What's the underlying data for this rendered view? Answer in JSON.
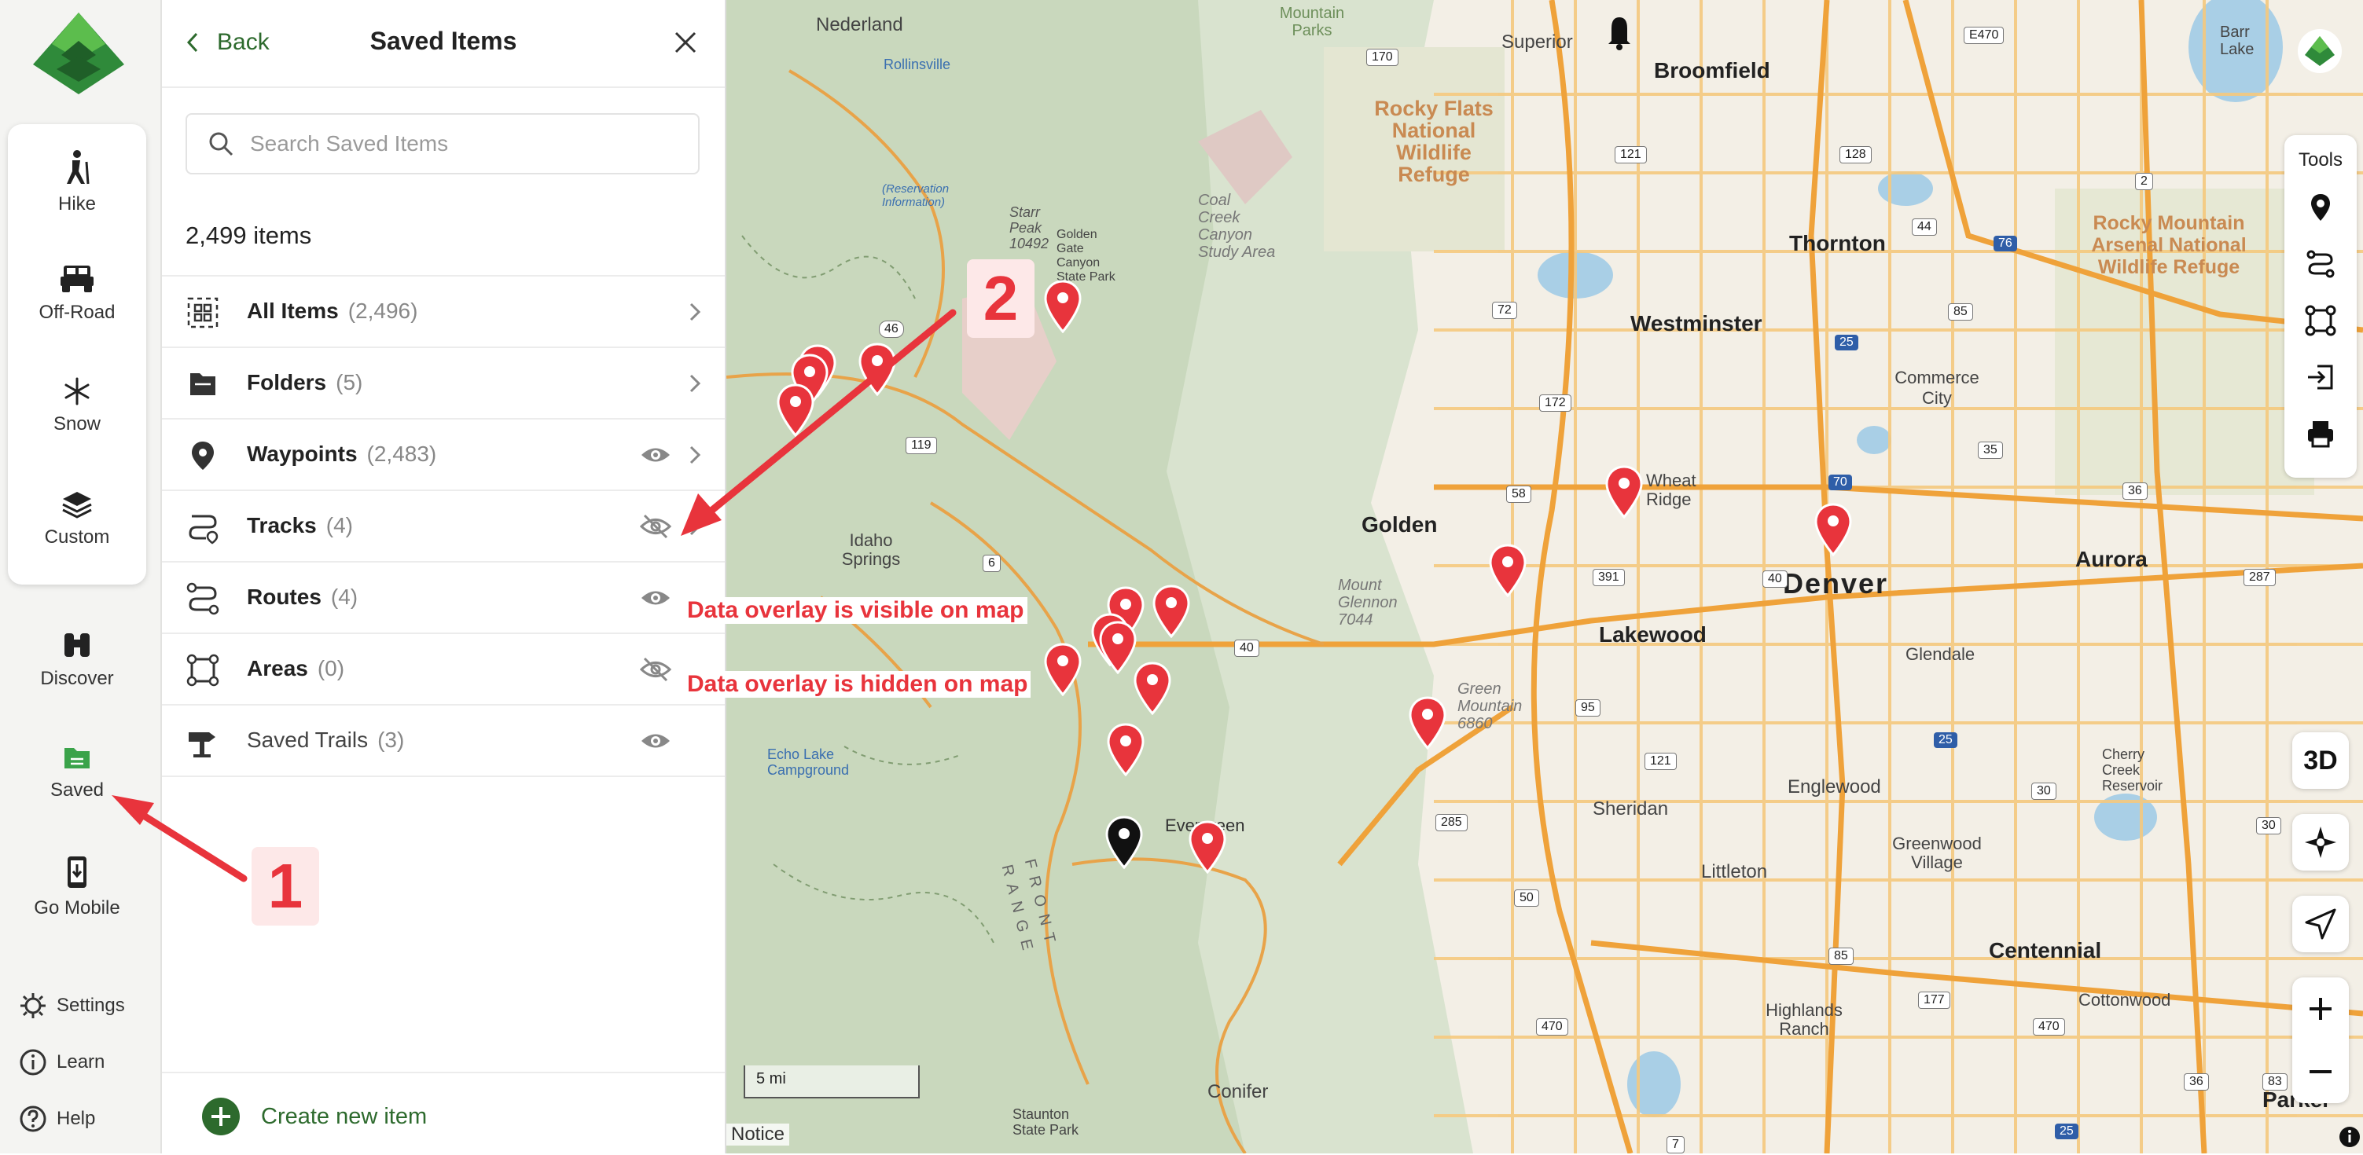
{
  "rail": {
    "items": [
      {
        "label": "Hike",
        "icon": "hiker-icon"
      },
      {
        "label": "Off-Road",
        "icon": "jeep-icon"
      },
      {
        "label": "Snow",
        "icon": "snowflake-icon"
      },
      {
        "label": "Custom",
        "icon": "layers-icon"
      }
    ],
    "discover": "Discover",
    "saved": "Saved",
    "go_mobile": "Go Mobile",
    "settings": "Settings",
    "learn": "Learn",
    "help": "Help"
  },
  "panel": {
    "back_label": "Back",
    "title": "Saved Items",
    "search_placeholder": "Search Saved Items",
    "count_label": "2,499 items",
    "rows": [
      {
        "name": "All Items",
        "count": "(2,496)",
        "eye": "none",
        "chevron": true
      },
      {
        "name": "Folders",
        "count": "(5)",
        "eye": "none",
        "chevron": true
      },
      {
        "name": "Waypoints",
        "count": "(2,483)",
        "eye": "visible",
        "chevron": true
      },
      {
        "name": "Tracks",
        "count": "(4)",
        "eye": "hidden",
        "chevron": true
      },
      {
        "name": "Routes",
        "count": "(4)",
        "eye": "visible",
        "chevron": false
      },
      {
        "name": "Areas",
        "count": "(0)",
        "eye": "hidden",
        "chevron": false
      },
      {
        "name": "Saved Trails",
        "count": "(3)",
        "eye": "visible",
        "chevron": false
      }
    ],
    "create_label": "Create new item"
  },
  "map": {
    "place_labels": {
      "nederland": "Nederland",
      "broomfield": "Broomfield",
      "superior": "Superior",
      "rocky_flats": "Rocky Flats National Wildlife Refuge",
      "thornton": "Thornton",
      "westminster": "Westminster",
      "rocky_mountain_arsenal": "Rocky Mountain Arsenal National Wildlife Refuge",
      "commerce_city": "Commerce City",
      "golden": "Golden",
      "wheat_ridge": "Wheat Ridge",
      "denver": "Denver",
      "aurora": "Aurora",
      "lakewood": "Lakewood",
      "idaho_springs": "Idaho Springs",
      "glendale": "Glendale",
      "englewood": "Englewood",
      "sheridan": "Sheridan",
      "littleton": "Littleton",
      "greenwood_village": "Greenwood Village",
      "centennial": "Centennial",
      "evergreen": "Evergreen",
      "conifer": "Conifer",
      "highlands_ranch": "Highlands Ranch",
      "cottonwood": "Cottonwood",
      "parker": "Parker",
      "cherry_creek": "Cherry Creek Reservoir",
      "front_range": "FRONT RANGE",
      "echo_lake": "Echo Lake Campground",
      "rollinsville": "Rollinsville",
      "golden_gate": "Golden Gate Canyon State Park",
      "starr_peak": "Starr Peak 10492",
      "coal_creek": "Coal Creek Canyon Study Area",
      "green_mountain": "Green Mountain 6860",
      "mount_glennon": "Mount Glennon 7044",
      "staunton": "Staunton State Park",
      "reservation": "(Reservation Information)",
      "mountain_parks": "Mountain Parks",
      "barr_lake": "Barr Lake"
    },
    "route_shields": [
      "170",
      "121",
      "128",
      "E470",
      "2",
      "44",
      "76",
      "72",
      "25",
      "85",
      "172",
      "46",
      "119",
      "58",
      "70",
      "35",
      "36",
      "391",
      "6",
      "40",
      "95",
      "121",
      "25",
      "287",
      "30",
      "470",
      "50",
      "85",
      "177",
      "470",
      "36",
      "25",
      "7",
      "285",
      "40",
      "30",
      "83"
    ],
    "callouts": {
      "visible_text": "Data overlay is visible on map",
      "hidden_text": "Data overlay is hidden on map",
      "step1": "1",
      "step2": "2"
    },
    "scale_label": "5 mi",
    "notice_label": "Notice",
    "tools_label": "Tools",
    "btn_3d": "3D"
  },
  "colors": {
    "brand_green": "#2d6a2d",
    "pin_red": "#e8343c",
    "callout_red": "#e8343c",
    "road_orange": "#f0b04a"
  }
}
